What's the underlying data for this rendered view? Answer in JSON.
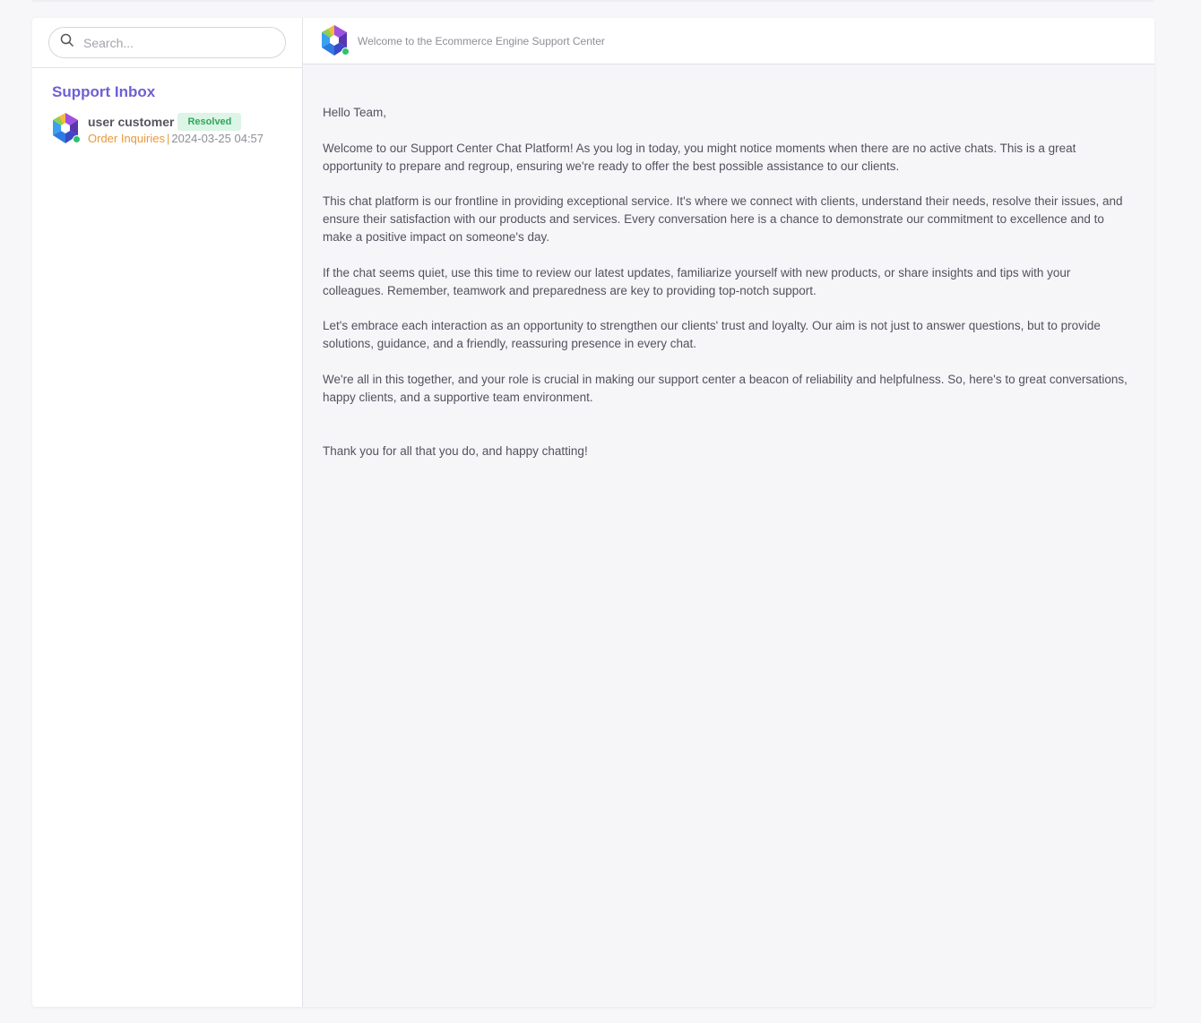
{
  "sidebar": {
    "search_placeholder": "Search...",
    "inbox_title": "Support Inbox",
    "conversations": [
      {
        "name": "user customer",
        "status": "Resolved",
        "category": "Order Inquiries",
        "separator": "|",
        "timestamp": "2024-03-25 04:57"
      }
    ]
  },
  "main": {
    "header_title": "Welcome to the Ecommerce Engine Support Center",
    "paragraphs": [
      "Hello Team,",
      "Welcome to our Support Center Chat Platform! As you log in today, you might notice moments when there are no active chats. This is a great opportunity to prepare and regroup, ensuring we're ready to offer the best possible assistance to our clients.",
      "This chat platform is our frontline in providing exceptional service. It's where we connect with clients, understand their needs, resolve their issues, and ensure their satisfaction with our products and services. Every conversation here is a chance to demonstrate our commitment to excellence and to make a positive impact on someone's day.",
      "If the chat seems quiet, use this time to review our latest updates, familiarize yourself with new products, or share insights and tips with your colleagues. Remember, teamwork and preparedness are key to providing top-notch support.",
      "Let's embrace each interaction as an opportunity to strengthen our clients' trust and loyalty. Our aim is not just to answer questions, but to provide solutions, guidance, and a friendly, reassuring presence in every chat.",
      "We're all in this together, and your role is crucial in making our support center a beacon of reliability and helpfulness. So, here's to great conversations, happy clients, and a supportive team environment.",
      "Thank you for all that you do, and happy chatting!"
    ]
  },
  "colors": {
    "accent": "#6e5fd6",
    "resolved": "#2fa65c",
    "category": "#e89a3c",
    "online": "#2ec26b"
  }
}
